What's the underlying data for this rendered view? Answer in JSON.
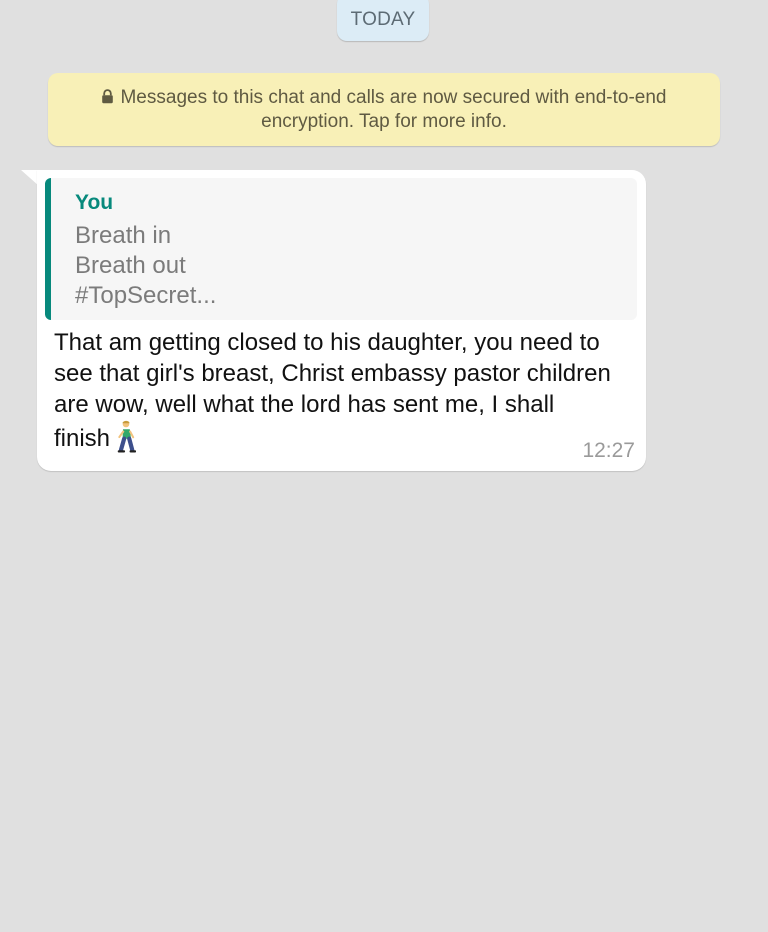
{
  "chat": {
    "date_label": "TODAY",
    "encryption_notice": "Messages to this chat and calls are now secured with end-to-end encryption. Tap for more info.",
    "message": {
      "quoted_reply": {
        "author": "You",
        "lines": [
          "Breath in",
          "Breath out",
          "#TopSecret..."
        ]
      },
      "text": "That am getting closed to his daughter, you need to see that girl's breast, Christ embassy pastor children are wow, well what the lord has sent me, I shall finish",
      "emoji_icon": "person-walking-icon",
      "time": "12:27"
    }
  },
  "colors": {
    "background": "#e0e0e0",
    "date_chip": "#dcecf6",
    "notice_background": "#f8f0b7",
    "quote_accent": "#07897c",
    "bubble_background": "#ffffff"
  }
}
